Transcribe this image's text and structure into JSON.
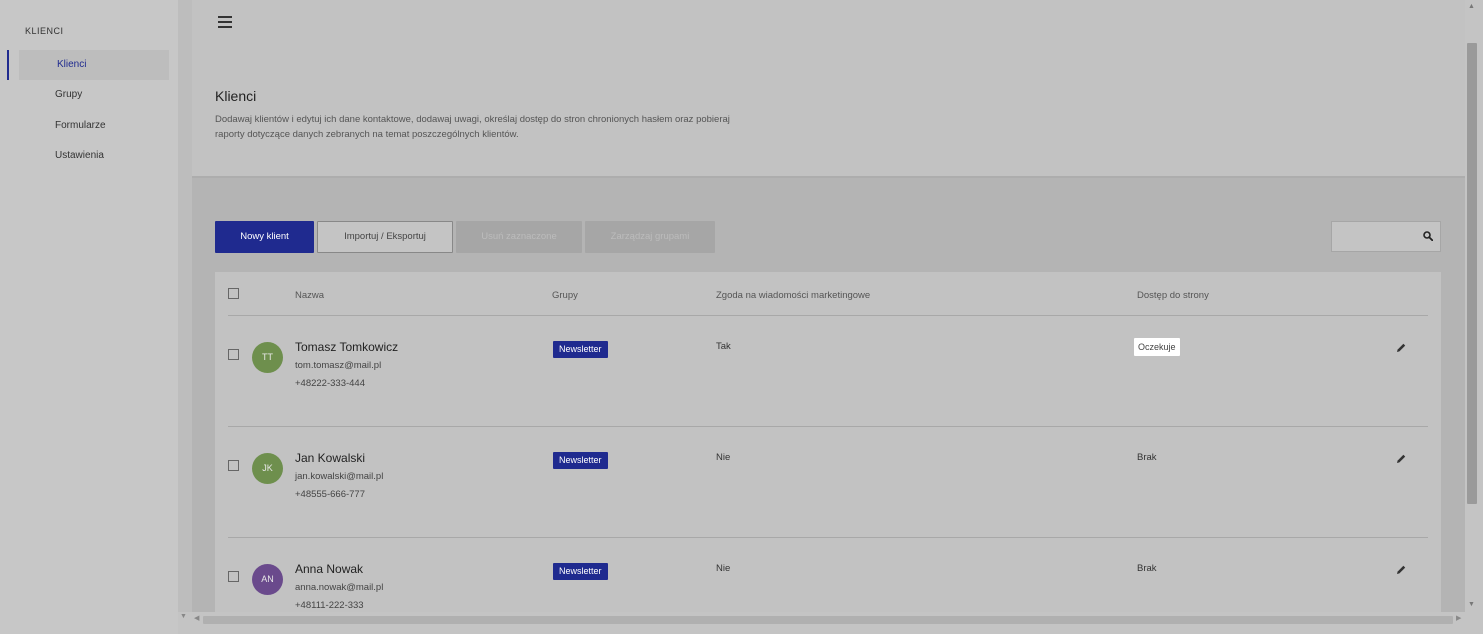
{
  "sidebar": {
    "heading": "KLIENCI",
    "items": [
      {
        "label": "Klienci",
        "active": true
      },
      {
        "label": "Grupy",
        "active": false
      },
      {
        "label": "Formularze",
        "active": false
      },
      {
        "label": "Ustawienia",
        "active": false
      }
    ]
  },
  "header": {
    "title": "Klienci",
    "description": "Dodawaj klientów i edytuj ich dane kontaktowe, dodawaj uwagi, określaj dostęp do stron chronionych hasłem oraz pobieraj raporty dotyczące danych zebranych na temat poszczególnych klientów."
  },
  "toolbar": {
    "new_client": "Nowy klient",
    "import_export": "Importuj / Eksportuj",
    "delete_selected": "Usuń zaznaczone",
    "manage_groups": "Zarządzaj grupami",
    "search_value": ""
  },
  "table": {
    "columns": [
      "Nazwa",
      "Grupy",
      "Zgoda na wiadomości marketingowe",
      "Dostęp do strony"
    ],
    "rows": [
      {
        "initials": "TT",
        "avatar_color": "#6e8f4d",
        "name": "Tomasz Tomkowicz",
        "email": "tom.tomasz@mail.pl",
        "phone": "+48222-333-444",
        "group": "Newsletter",
        "consent": "Tak",
        "access": "Oczekuje",
        "access_pill": true
      },
      {
        "initials": "JK",
        "avatar_color": "#6e8f4d",
        "name": "Jan Kowalski",
        "email": "jan.kowalski@mail.pl",
        "phone": "+48555-666-777",
        "group": "Newsletter",
        "consent": "Nie",
        "access": "Brak",
        "access_pill": false
      },
      {
        "initials": "AN",
        "avatar_color": "#6a4a8c",
        "name": "Anna Nowak",
        "email": "anna.nowak@mail.pl",
        "phone": "+48111-222-333",
        "group": "Newsletter",
        "consent": "Nie",
        "access": "Brak",
        "access_pill": false
      }
    ]
  },
  "colors": {
    "accent": "#1f2a8f"
  }
}
